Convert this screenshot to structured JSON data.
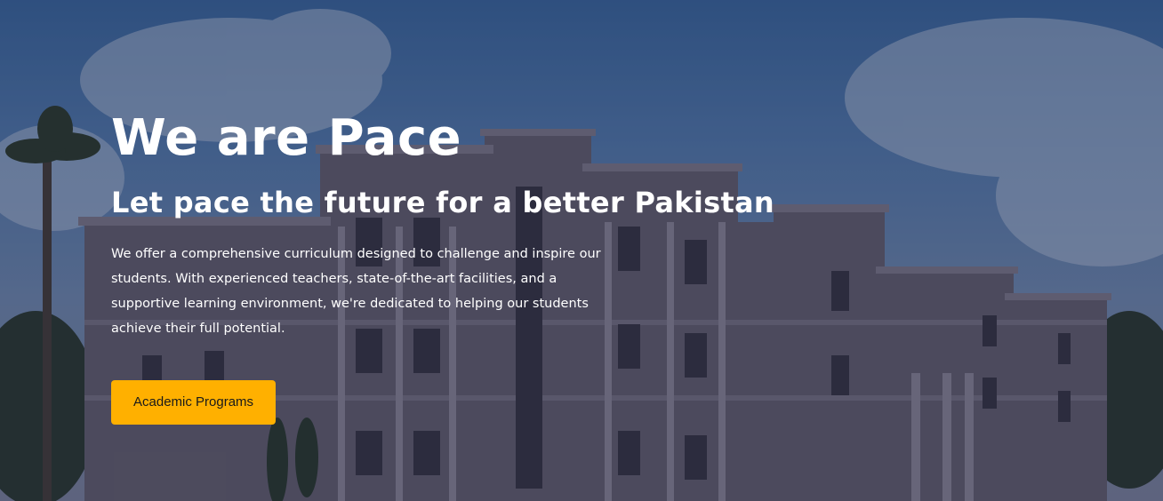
{
  "hero": {
    "title": "We are Pace",
    "subtitle": "Let pace the future for a better Pakistan",
    "description": "We offer a comprehensive curriculum designed to challenge and inspire our students. With experienced teachers, state-of-the-art facilities, and a supportive learning environment, we're dedicated to helping our students achieve their full potential.",
    "cta_label": "Academic Programs"
  },
  "colors": {
    "accent": "#ffb000",
    "sky": "#4a78b0",
    "building": "#6d6571"
  }
}
